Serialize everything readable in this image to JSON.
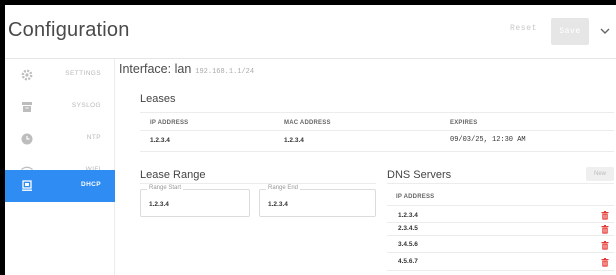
{
  "app": {
    "title": "Configuration"
  },
  "toolbar": {
    "reset_label": "Reset",
    "save_label": "Save"
  },
  "sidebar": {
    "items": [
      {
        "label": "SETTINGS",
        "icon": "gear-icon"
      },
      {
        "label": "SYSLOG",
        "icon": "archive-icon"
      },
      {
        "label": "NTP",
        "icon": "clock-icon"
      },
      {
        "label": "WIFI",
        "icon": "wifi-icon"
      },
      {
        "label": "DHCP",
        "icon": "dhcp-icon"
      }
    ],
    "active": "DHCP",
    "accent_color": "#2f8cf2"
  },
  "interface": {
    "label": "Interface: lan",
    "subtitle": "192.168.1.1/24"
  },
  "leases": {
    "title": "Leases",
    "columns": [
      "IP ADDRESS",
      "MAC ADDRESS",
      "EXPIRES"
    ],
    "rows": [
      {
        "ip": "1.2.3.4",
        "mac": "1.2.3.4",
        "expires": "09/03/25, 12:30 AM"
      }
    ]
  },
  "lease_range": {
    "title": "Lease Range",
    "start_label": "Range Start",
    "start_value": "1.2.3.4",
    "end_label": "Range End",
    "end_value": "1.2.3.4"
  },
  "dns": {
    "title": "DNS Servers",
    "new_label": "New",
    "column": "IP ADDRESS",
    "servers": [
      "1.2.3.4",
      "2.3.4.5",
      "3.4.5.6",
      "4.5.6.7"
    ],
    "delete_color": "#e53935"
  }
}
